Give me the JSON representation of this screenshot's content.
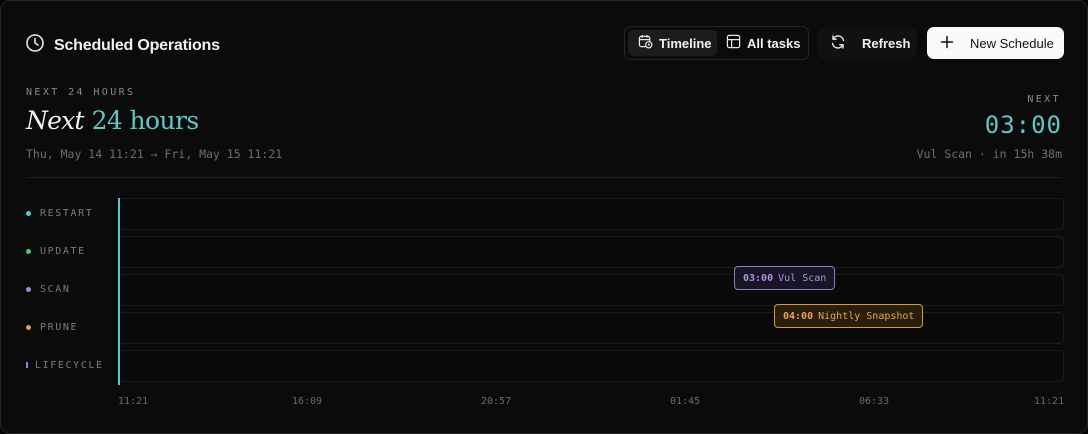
{
  "header": {
    "title": "Scheduled Operations",
    "title_icon": "clock-icon",
    "tabs": [
      {
        "label": "Timeline",
        "icon": "calendar-clock-icon",
        "active": true
      },
      {
        "label": "All tasks",
        "icon": "table-icon",
        "active": false
      }
    ],
    "refresh_label": "Refresh",
    "new_schedule_label": "New Schedule"
  },
  "summary": {
    "eyebrow": "NEXT 24 HOURS",
    "heading_italic": "Next",
    "heading_accent": "24 hours",
    "range": "Thu, May 14 11:21 → Fri, May 15 11:21",
    "next_eyebrow": "NEXT",
    "next_time": "03:00",
    "next_detail": "Vul Scan · in 15h 38m"
  },
  "lanes": [
    {
      "label": "RESTART",
      "color": "#5fc6c9"
    },
    {
      "label": "UPDATE",
      "color": "#3fcf7a"
    },
    {
      "label": "SCAN",
      "color": "#a489e8"
    },
    {
      "label": "PRUNE",
      "color": "#e0a04a"
    },
    {
      "label": "LIFECYCLE",
      "color": "#7b8cf0"
    }
  ],
  "events": [
    {
      "lane": "SCAN",
      "time": "03:00",
      "name": "Vul Scan",
      "color": "#a896df"
    },
    {
      "lane": "PRUNE",
      "time": "04:00",
      "name": "Nightly Snapshot",
      "color": "#e3a450"
    }
  ],
  "axis_ticks": [
    "11:21",
    "16:09",
    "20:57",
    "01:45",
    "06:33",
    "11:21"
  ],
  "colors": {
    "accent": "#5fc6c9",
    "background": "#0b0b0b"
  }
}
